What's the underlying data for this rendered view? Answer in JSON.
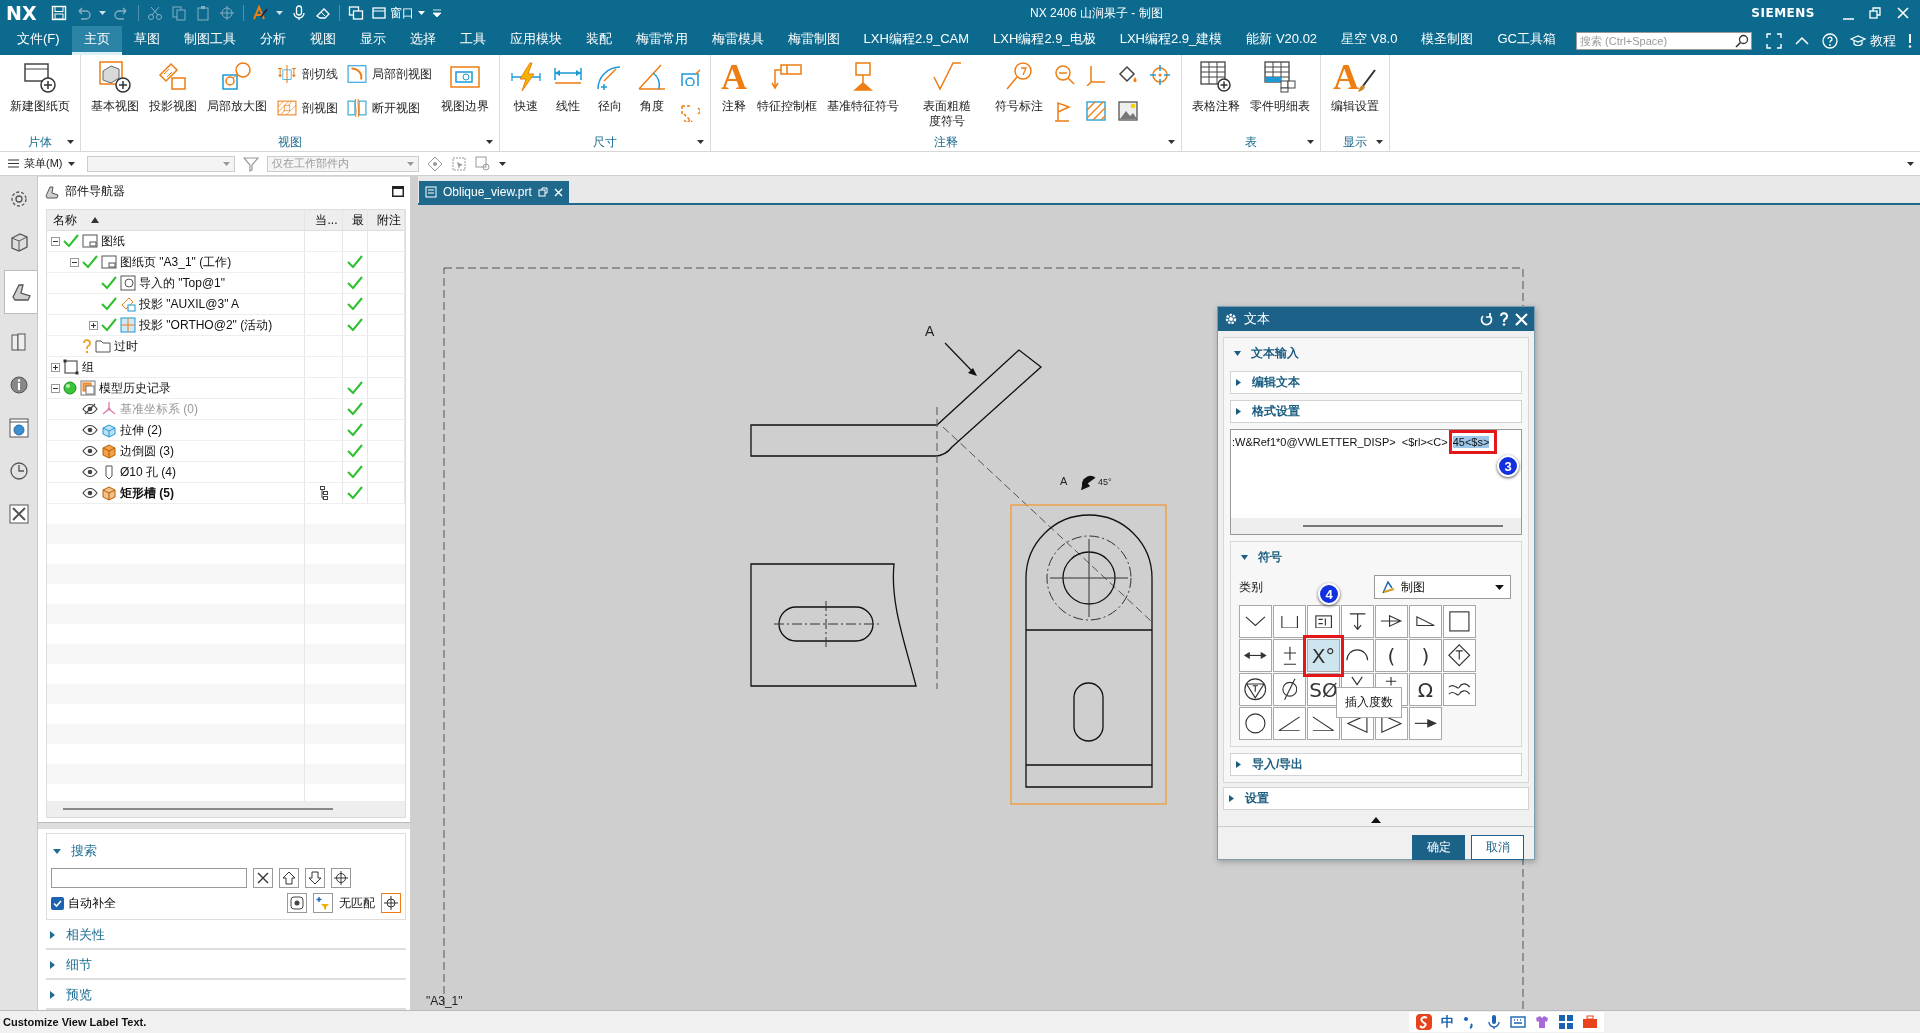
{
  "title_bar": {
    "app": "NX",
    "window_menu": "窗口",
    "title": "NX 2406 山涧果子 - 制图",
    "brand": "SIEMENS"
  },
  "menu_bar": {
    "tabs": [
      {
        "label": "文件(F)",
        "selected": false
      },
      {
        "label": "主页",
        "selected": true
      },
      {
        "label": "草图",
        "selected": false
      },
      {
        "label": "制图工具",
        "selected": false
      },
      {
        "label": "分析",
        "selected": false
      },
      {
        "label": "视图",
        "selected": false
      },
      {
        "label": "显示",
        "selected": false
      },
      {
        "label": "选择",
        "selected": false
      },
      {
        "label": "工具",
        "selected": false
      },
      {
        "label": "应用模块",
        "selected": false
      },
      {
        "label": "装配",
        "selected": false
      },
      {
        "label": "梅雷常用",
        "selected": false
      },
      {
        "label": "梅雷模具",
        "selected": false
      },
      {
        "label": "梅雷制图",
        "selected": false
      },
      {
        "label": "LXH编程2.9_CAM",
        "selected": false
      },
      {
        "label": "LXH编程2.9_电极",
        "selected": false
      },
      {
        "label": "LXH编程2.9_建模",
        "selected": false
      },
      {
        "label": "能新 V20.02",
        "selected": false
      },
      {
        "label": "星空 V8.0",
        "selected": false
      },
      {
        "label": "模圣制图",
        "selected": false
      },
      {
        "label": "GC工具箱",
        "selected": false
      }
    ],
    "search": {
      "placeholder": "搜索 (Ctrl+Space)"
    },
    "tutorial": "教程"
  },
  "ribbon": {
    "groups": [
      {
        "label": "片体",
        "items": [
          {
            "label": "新建图纸页",
            "kind": "large"
          }
        ]
      },
      {
        "label": "视图",
        "items": [
          {
            "label": "基本视图",
            "kind": "large"
          },
          {
            "label": "投影视图",
            "kind": "large"
          },
          {
            "label": "局部放大图",
            "kind": "large"
          },
          {
            "label": "剖切线",
            "kind": "small"
          },
          {
            "label": "剖视图",
            "kind": "small"
          },
          {
            "label": "局部剖视图",
            "kind": "small"
          },
          {
            "label": "断开视图",
            "kind": "small"
          },
          {
            "label": "视图边界",
            "kind": "large"
          }
        ]
      },
      {
        "label": "尺寸",
        "items": [
          {
            "label": "快速",
            "kind": "large"
          },
          {
            "label": "线性",
            "kind": "large"
          },
          {
            "label": "径向",
            "kind": "large"
          },
          {
            "label": "角度",
            "kind": "large"
          },
          {
            "kind": "icon"
          },
          {
            "kind": "icon"
          }
        ]
      },
      {
        "label": "注释",
        "items": [
          {
            "label": "注释",
            "kind": "large",
            "glyph": "A"
          },
          {
            "label": "特征控制框",
            "kind": "large"
          },
          {
            "label": "基准特征符号",
            "kind": "large"
          },
          {
            "label": "表面粗糙度符号",
            "kind": "large"
          },
          {
            "label": "符号标注",
            "kind": "large"
          },
          {
            "kind": "icon"
          },
          {
            "kind": "icon"
          },
          {
            "kind": "icon"
          },
          {
            "kind": "icon"
          },
          {
            "kind": "icon"
          },
          {
            "kind": "icon"
          },
          {
            "kind": "icon"
          }
        ]
      },
      {
        "label": "表",
        "items": [
          {
            "label": "表格注释",
            "kind": "large"
          },
          {
            "label": "零件明细表",
            "kind": "large"
          }
        ]
      },
      {
        "label": "显示",
        "items": [
          {
            "label": "编辑设置",
            "kind": "large",
            "glyph": "A"
          }
        ]
      }
    ]
  },
  "toolbar": {
    "menu": "菜单(M)",
    "scope": "仅在工作部件内"
  },
  "side_tabs": [
    {
      "selected": false
    },
    {
      "selected": false
    },
    {
      "selected": true
    },
    {
      "selected": false
    },
    {
      "selected": false
    },
    {
      "selected": false
    },
    {
      "selected": false
    },
    {
      "selected": false
    }
  ],
  "navigator": {
    "title": "部件导航器",
    "columns": [
      "名称",
      "当...",
      "最",
      "附注"
    ],
    "tree": [
      {
        "label": "图纸",
        "kind": "sheet",
        "expanded": true,
        "checked": true,
        "latest": false,
        "children": [
          {
            "label": "图纸页 \"A3_1\" (工作)",
            "kind": "sheet",
            "expanded": true,
            "checked": true,
            "latest": true,
            "children": [
              {
                "label": "导入的 \"Top@1\"",
                "kind": "view",
                "checked": true,
                "latest": true
              },
              {
                "label": "投影 \"AUXIL@3\" A",
                "kind": "projection",
                "checked": true,
                "latest": true
              },
              {
                "label": "投影 \"ORTHO@2\" (活动)",
                "kind": "ortho",
                "expanded": false,
                "checked": true,
                "latest": true
              }
            ]
          },
          {
            "label": "过时",
            "kind": "folder",
            "checked": false,
            "latest": false
          }
        ]
      },
      {
        "label": "组",
        "kind": "group",
        "expanded": false,
        "latest": false
      },
      {
        "label": "模型历史记录",
        "kind": "history",
        "expanded": true,
        "latest": true,
        "children": [
          {
            "label": "基准坐标系 (0)",
            "kind": "datum",
            "hidden": true,
            "current": false,
            "latest": true
          },
          {
            "label": "拉伸 (2)",
            "kind": "extrude",
            "hidden": false,
            "current": false,
            "latest": true
          },
          {
            "label": "边倒圆 (3)",
            "kind": "blend",
            "hidden": false,
            "current": false,
            "latest": true
          },
          {
            "label": "Ø10 孔 (4)",
            "kind": "hole",
            "hidden": false,
            "current": false,
            "latest": true
          },
          {
            "label": "矩形槽 (5)",
            "kind": "slot",
            "hidden": false,
            "current": true,
            "latest": true
          }
        ]
      }
    ],
    "search": {
      "title": "搜索",
      "expanded": true,
      "autocomplete": {
        "label": "自动补全",
        "checked": true
      },
      "status": "无匹配"
    },
    "sections": [
      {
        "label": "相关性",
        "expanded": false
      },
      {
        "label": "细节",
        "expanded": false
      },
      {
        "label": "预览",
        "expanded": false
      }
    ]
  },
  "document_tab": {
    "label": "Oblique_view.prt"
  },
  "drawing": {
    "section_label": "A",
    "view_label": "A",
    "angle": "45°",
    "sheet_name": "\"A3_1\""
  },
  "dialog": {
    "title": "文本",
    "text_input": {
      "label": "文本输入",
      "expanded": true,
      "subsections": [
        {
          "label": "编辑文本",
          "expanded": false
        },
        {
          "label": "格式设置",
          "expanded": false
        }
      ],
      "text": ":W&Ref1*0@VWLETTER_DISP>  <$rl><C>",
      "selection": "45<$s>",
      "callout": "3"
    },
    "symbols": {
      "label": "符号",
      "expanded": true,
      "category_label": "类别",
      "category": "制图",
      "callout": "4",
      "tooltip": "插入度数",
      "items": [
        {
          "selected": false
        },
        {
          "selected": false
        },
        {
          "selected": false
        },
        {
          "selected": false
        },
        {
          "selected": false
        },
        {
          "selected": false
        },
        {
          "selected": false
        },
        {
          "selected": false
        },
        {
          "selected": false
        },
        {
          "text": "X°",
          "selected": true
        },
        {
          "selected": false
        },
        {
          "text": "(",
          "selected": false
        },
        {
          "text": ")",
          "selected": false
        },
        {
          "selected": false
        },
        {
          "selected": false
        },
        {
          "selected": false
        },
        {
          "text": "SØ",
          "selected": false
        },
        {
          "selected": false
        },
        {
          "selected": false
        },
        {
          "text": "Ω",
          "selected": false
        },
        {
          "selected": false
        },
        {
          "selected": false
        },
        {
          "selected": false
        },
        {
          "selected": false
        },
        {
          "selected": false
        },
        {
          "selected": false
        },
        {
          "selected": false
        }
      ]
    },
    "import_export": {
      "label": "导入/导出",
      "expanded": false
    },
    "settings": {
      "label": "设置",
      "expanded": false
    },
    "buttons": [
      {
        "label": "确定",
        "primary": true
      },
      {
        "label": "取消",
        "primary": false
      }
    ]
  },
  "status_bar": {
    "message": "Customize View Label Text.",
    "ime_mode": "中"
  }
}
